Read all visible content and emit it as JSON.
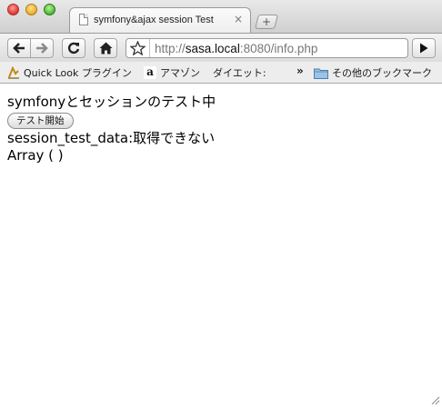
{
  "window": {
    "tab_title": "symfony&ajax session Test",
    "tab_close_glyph": "×",
    "new_tab_glyph": "+"
  },
  "toolbar": {
    "url_scheme": "http://",
    "url_host": "sasa.local",
    "url_rest": ":8080/info.php"
  },
  "bookmarks": {
    "items": [
      {
        "label": "Quick Look プラグイン",
        "icon": "quicklook-icon"
      },
      {
        "label": "アマゾン",
        "icon": "amazon-icon"
      },
      {
        "label": "ダイエット:",
        "icon": "none"
      }
    ],
    "overflow_glyph": "»",
    "other_bookmarks_label": "その他のブックマーク"
  },
  "page": {
    "heading": "symfonyとセッションのテスト中",
    "button_label": "テスト開始",
    "session_line": "session_test_data:取得できない",
    "array_line": "Array ( )"
  },
  "colors": {
    "close": "#e0443c",
    "minimize": "#f0b43a",
    "maximize": "#58c23f"
  }
}
